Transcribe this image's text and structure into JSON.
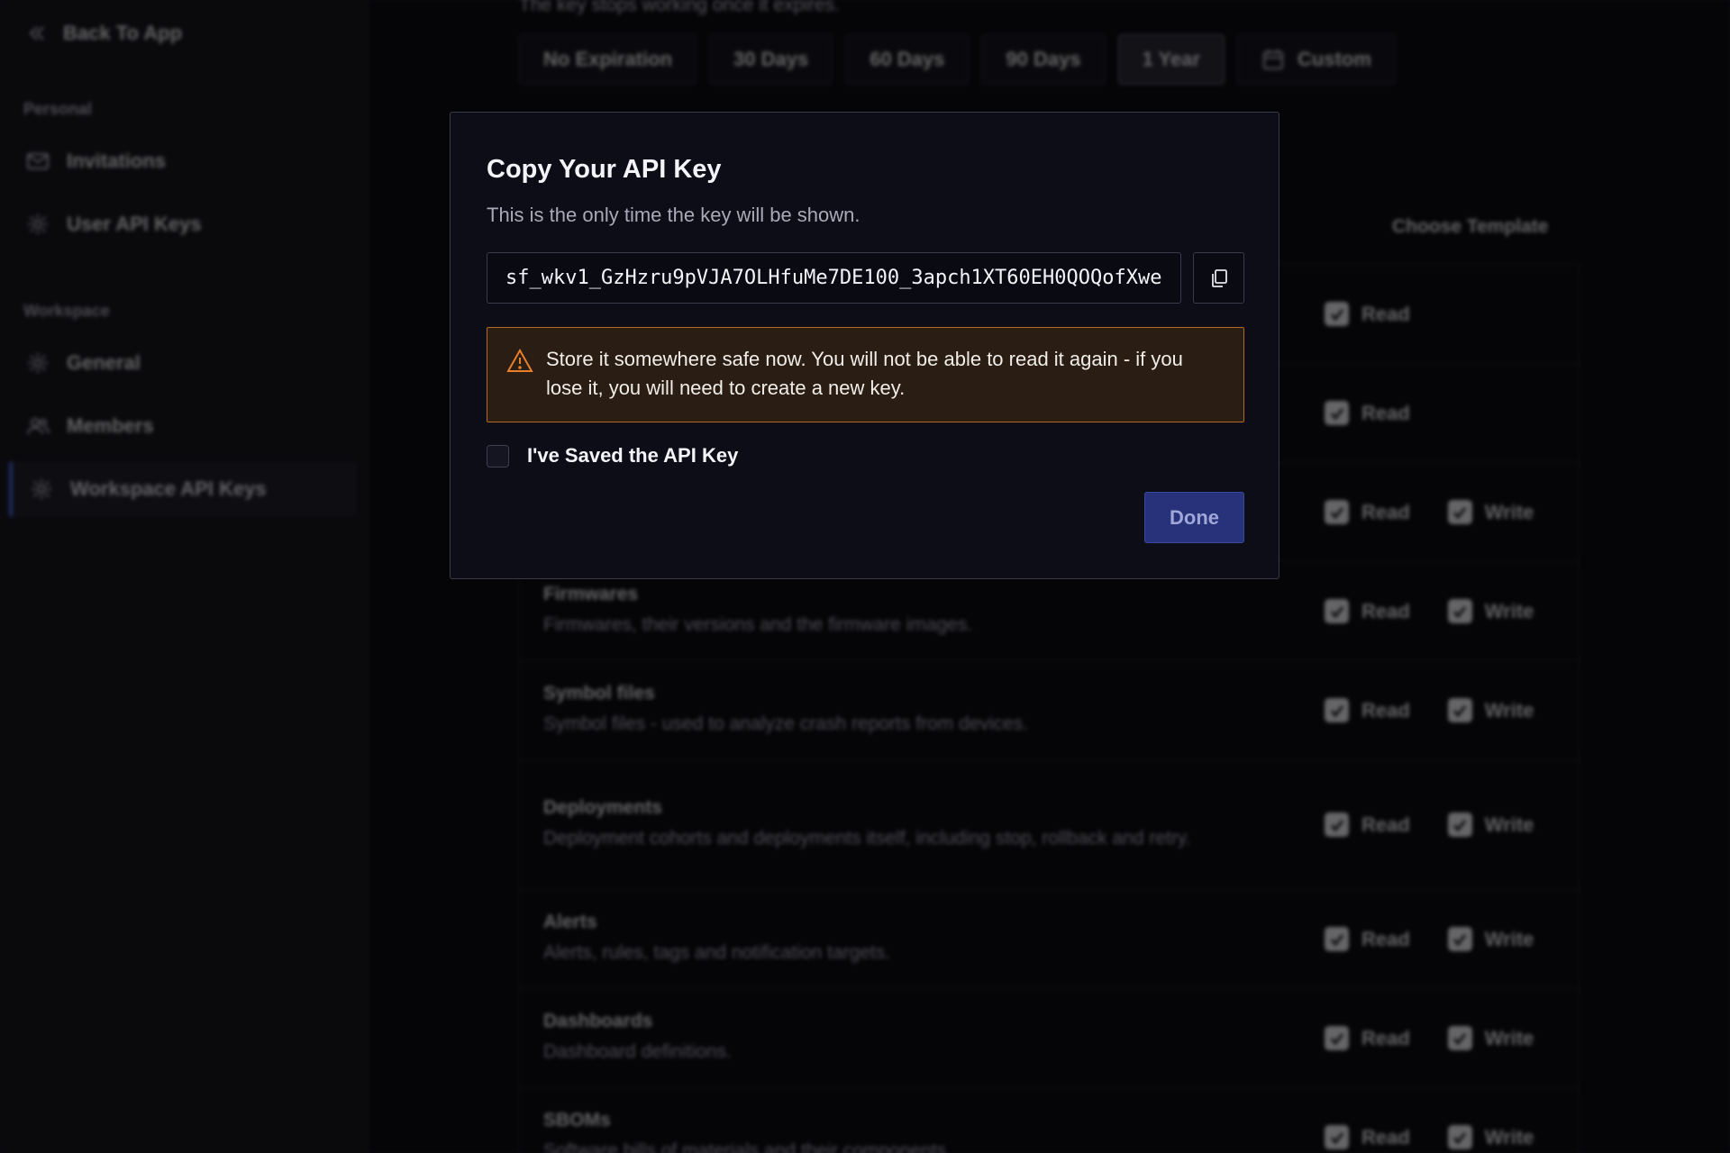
{
  "sidebar": {
    "back_label": "Back To App",
    "sections": [
      {
        "label": "Personal",
        "items": [
          {
            "label": "Invitations"
          },
          {
            "label": "User API Keys"
          }
        ]
      },
      {
        "label": "Workspace",
        "items": [
          {
            "label": "General"
          },
          {
            "label": "Members"
          },
          {
            "label": "Workspace API Keys"
          }
        ]
      }
    ],
    "active_item": "Workspace API Keys"
  },
  "expiration": {
    "hint": "The key stops working once it expires.",
    "options": [
      "No Expiration",
      "30 Days",
      "60 Days",
      "90 Days",
      "1 Year",
      "Custom"
    ],
    "selected": "1 Year"
  },
  "permissions": {
    "template_label": "Choose Template",
    "read_label": "Read",
    "write_label": "Write",
    "rows": [
      {
        "title": "",
        "desc": "",
        "read": true,
        "write": null
      },
      {
        "title": "",
        "desc": "",
        "read": true,
        "write": null
      },
      {
        "title": "",
        "desc": "",
        "read": true,
        "write": true
      },
      {
        "title": "Firmwares",
        "desc": "Firmwares, their versions and the firmware images.",
        "read": true,
        "write": true
      },
      {
        "title": "Symbol files",
        "desc": "Symbol files - used to analyze crash reports from devices.",
        "read": true,
        "write": true
      },
      {
        "title": "Deployments",
        "desc": "Deployment cohorts and deployments itself, including stop, rollback and retry.",
        "read": true,
        "write": true
      },
      {
        "title": "Alerts",
        "desc": "Alerts, rules, tags and notification targets.",
        "read": true,
        "write": true
      },
      {
        "title": "Dashboards",
        "desc": "Dashboard definitions.",
        "read": true,
        "write": true
      },
      {
        "title": "SBOMs",
        "desc": "Software bills of materials and their components",
        "read": true,
        "write": true
      }
    ]
  },
  "modal": {
    "title": "Copy Your API Key",
    "subtitle": "This is the only time the key will be shown.",
    "api_key": "sf_wkv1_GzHzru9pVJA7OLHfuMe7DE100_3apch1XT60EH0QOQofXwe",
    "warning": "Store it somewhere safe now. You will not be able to read it again - if you lose it, you will need to create a new key.",
    "confirm_label": "I've Saved the API Key",
    "confirm_checked": false,
    "done_label": "Done"
  },
  "colors": {
    "accent": "#4d6be5",
    "warning_border": "#b36b22",
    "warning_bg": "#2a1d14",
    "done_button": "#27327a"
  }
}
